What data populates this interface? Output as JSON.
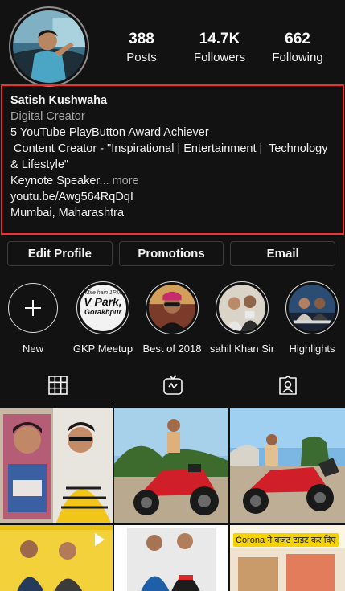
{
  "profile": {
    "stats": [
      {
        "value": "388",
        "label": "Posts"
      },
      {
        "value": "14.7K",
        "label": "Followers"
      },
      {
        "value": "662",
        "label": "Following"
      }
    ]
  },
  "bio": {
    "name": "Satish Kushwaha",
    "category": "Digital Creator",
    "line1": "5 YouTube PlayButton Award Achiever",
    "line2": " Content Creator - \"Inspirational | Entertainment |  Technology",
    "line3": "& Lifestyle\"",
    "line4_start": "Keynote Speaker",
    "line4_more": "... more",
    "link": "youtu.be/Awg564RqDqI",
    "location": "Mumbai, Maharashtra"
  },
  "buttons": {
    "edit": "Edit Profile",
    "promotions": "Promotions",
    "email": "Email"
  },
  "highlights": [
    {
      "label": "New",
      "icon": "plus-icon"
    },
    {
      "label": "GKP Meetup",
      "cover_text": "V Park,",
      "cover_sub": "Gorakhpur",
      "cover_top": "Mite hain 1PM"
    },
    {
      "label": "Best of 2018"
    },
    {
      "label": "sahil Khan Sir"
    },
    {
      "label": "Highlights"
    }
  ],
  "tabs": [
    {
      "name": "grid",
      "icon": "grid-icon"
    },
    {
      "name": "igtv",
      "icon": "igtv-icon"
    },
    {
      "name": "tagged",
      "icon": "tagged-icon"
    }
  ],
  "grid_overlay": {
    "corona_text": "Corona ने बजट टाइट कर दिए"
  },
  "colors": {
    "background": "#121212",
    "bio_highlight_border": "#e8342e",
    "secondary_text": "#a8a8a8"
  }
}
